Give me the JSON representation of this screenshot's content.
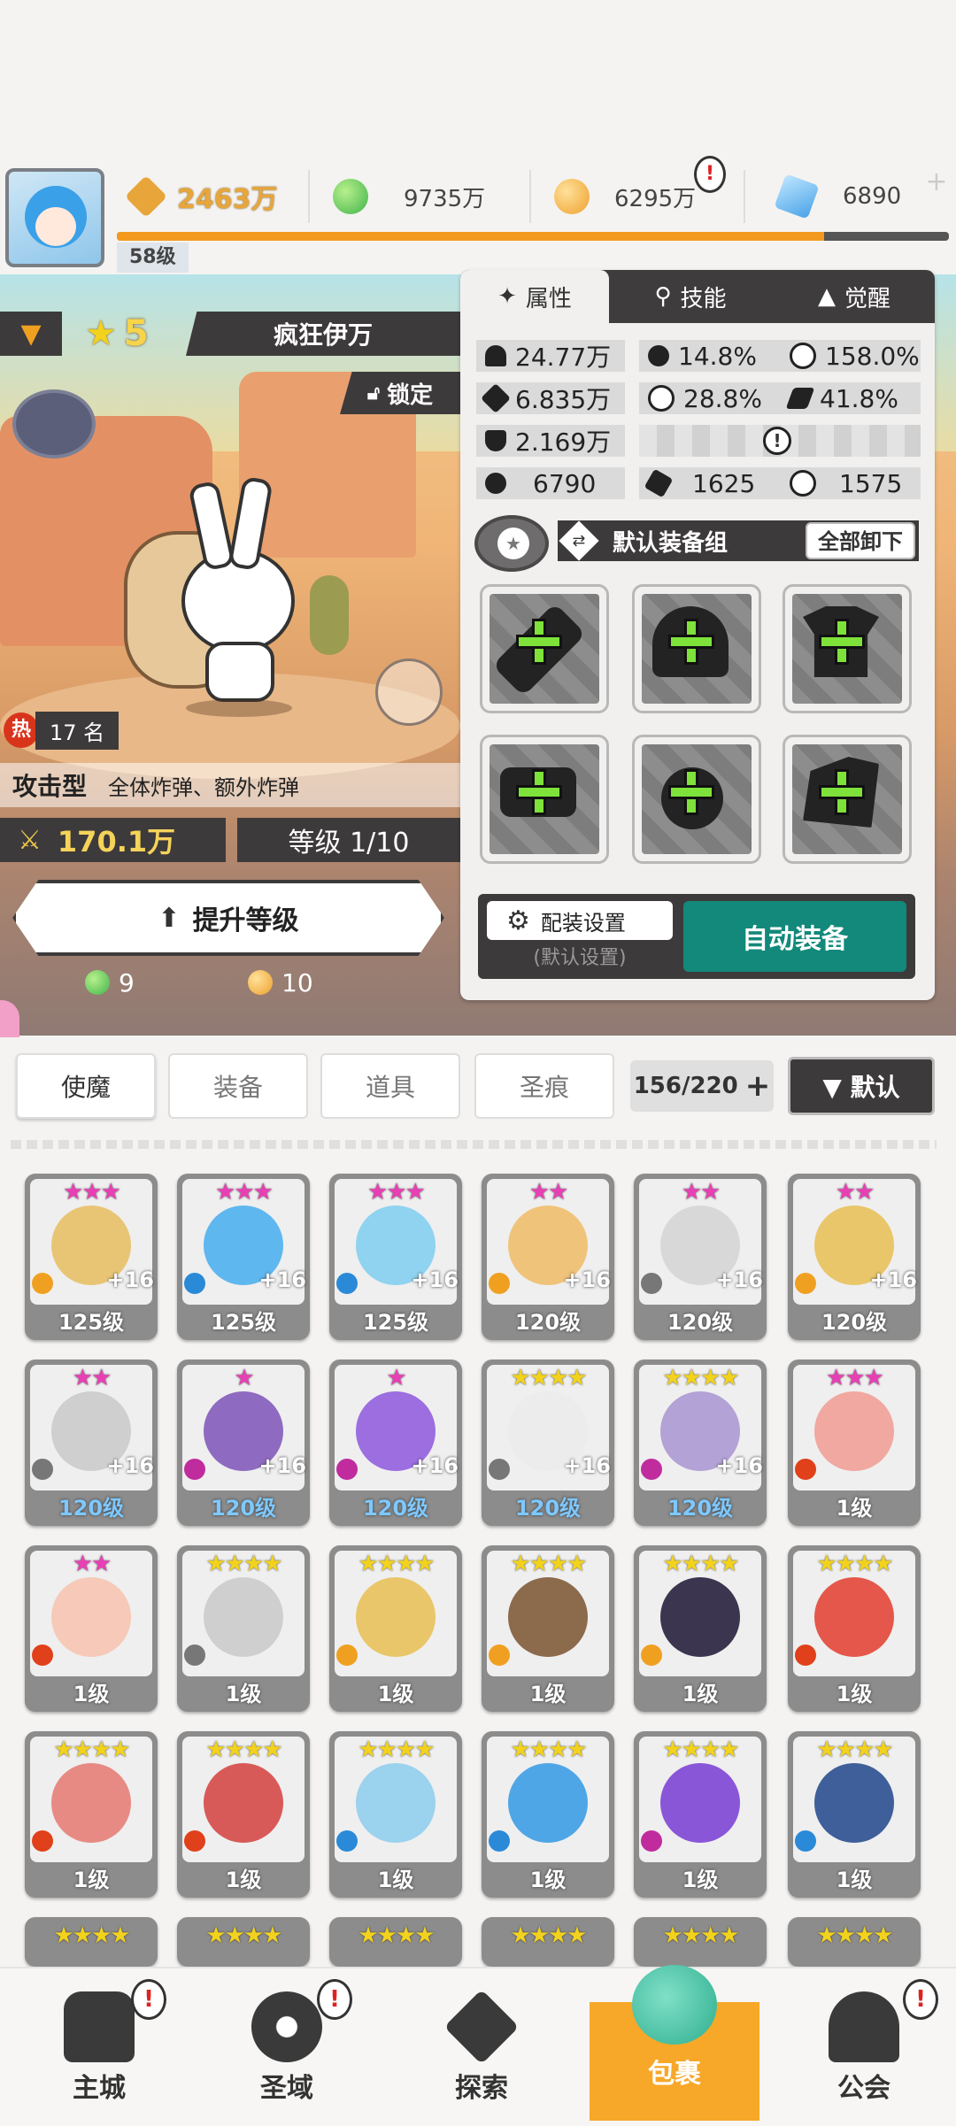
{
  "top": {
    "level": "58级",
    "power": "2463万",
    "green_currency": "9735万",
    "gold_currency": "6295万",
    "gem_currency": "6890",
    "exp_fraction": 0.85
  },
  "hero": {
    "rank_stars": "5",
    "name": "疯狂伊万",
    "lock_label": "锁定",
    "hot_label": "热",
    "hot_rank": "17 名",
    "type": "攻击型",
    "type_desc": "全体炸弹、额外炸弹",
    "power": "170.1万",
    "level_text": "等级 1/10",
    "upgrade_label": "提升等级",
    "cost_green": "9",
    "cost_gold": "10"
  },
  "panel": {
    "tabs": [
      "属性",
      "技能",
      "觉醒"
    ],
    "stats": {
      "hp": "24.77万",
      "crit": "14.8%",
      "crit_dmg": "158.0%",
      "atk": "6.835万",
      "accuracy": "28.8%",
      "speed": "41.8%",
      "def": "2.169万",
      "s1": "6790",
      "s2": "1625",
      "s3": "1575"
    },
    "equip_set": "默认装备组",
    "unequip_all": "全部卸下",
    "config_label": "配装设置",
    "config_sub": "(默认设置)",
    "auto_equip": "自动装备"
  },
  "inventory": {
    "tabs": [
      "使魔",
      "装备",
      "道具",
      "圣痕"
    ],
    "count": "156/220",
    "sort_label": "▼ 默认",
    "rows": [
      [
        {
          "stars": "★★★",
          "star_color": "#e83fb4",
          "lv": "125级",
          "plus": "+16",
          "bg": "#e8c575",
          "el": "#f0a020"
        },
        {
          "stars": "★★★",
          "star_color": "#e83fb4",
          "lv": "125级",
          "plus": "+16",
          "bg": "#5fb7ef",
          "el": "#2a8ad8"
        },
        {
          "stars": "★★★",
          "star_color": "#e83fb4",
          "lv": "125级",
          "plus": "+16",
          "bg": "#8fd3f0",
          "el": "#2a8ad8"
        },
        {
          "stars": "★★",
          "star_color": "#e83fb4",
          "lv": "120级",
          "plus": "+16",
          "bg": "#f0c37a",
          "el": "#f0a020"
        },
        {
          "stars": "★★",
          "star_color": "#e83fb4",
          "lv": "120级",
          "plus": "+16",
          "bg": "#d8d8d8",
          "el": "#777"
        },
        {
          "stars": "★★",
          "star_color": "#e83fb4",
          "lv": "120级",
          "plus": "+16",
          "bg": "#e9c66a",
          "el": "#f0a020"
        }
      ],
      [
        {
          "stars": "★★",
          "star_color": "#e83fb4",
          "lv": "120级",
          "plus": "+16",
          "bg": "#cfcfcf",
          "el": "#777",
          "blue": true
        },
        {
          "stars": "★",
          "star_color": "#e83fb4",
          "lv": "120级",
          "plus": "+16",
          "bg": "#8e6bc0",
          "el": "#c02c9e",
          "blue": true
        },
        {
          "stars": "★",
          "star_color": "#e83fb4",
          "lv": "120级",
          "plus": "+16",
          "bg": "#9c6ee0",
          "el": "#c02c9e",
          "blue": true
        },
        {
          "stars": "★★★★",
          "star_color": "#f2d21c",
          "lv": "120级",
          "plus": "+16",
          "bg": "#ececec",
          "el": "#777",
          "blue": true
        },
        {
          "stars": "★★★★",
          "star_color": "#f2d21c",
          "lv": "120级",
          "plus": "+16",
          "bg": "#b3a2d6",
          "el": "#c02c9e",
          "blue": true
        },
        {
          "stars": "★★★",
          "star_color": "#e83fb4",
          "lv": "1级",
          "plus": "",
          "bg": "#f0a8a0",
          "el": "#e0401a"
        }
      ],
      [
        {
          "stars": "★★",
          "star_color": "#e83fb4",
          "lv": "1级",
          "plus": "",
          "bg": "#f6c9b8",
          "el": "#e0401a"
        },
        {
          "stars": "★★★★",
          "star_color": "#f2d21c",
          "lv": "1级",
          "plus": "",
          "bg": "#cfcfcf",
          "el": "#777"
        },
        {
          "stars": "★★★★",
          "star_color": "#f2d21c",
          "lv": "1级",
          "plus": "",
          "bg": "#e9c66a",
          "el": "#f0a020"
        },
        {
          "stars": "★★★★",
          "star_color": "#f2d21c",
          "lv": "1级",
          "plus": "",
          "bg": "#8c6a4c",
          "el": "#f0a020"
        },
        {
          "stars": "★★★★",
          "star_color": "#f2d21c",
          "lv": "1级",
          "plus": "",
          "bg": "#3c3550",
          "el": "#f0a020"
        },
        {
          "stars": "★★★★",
          "star_color": "#f2d21c",
          "lv": "1级",
          "plus": "",
          "bg": "#e4574a",
          "el": "#e0401a"
        }
      ],
      [
        {
          "stars": "★★★★",
          "star_color": "#f2d21c",
          "lv": "1级",
          "plus": "",
          "bg": "#e88a84",
          "el": "#e0401a"
        },
        {
          "stars": "★★★★",
          "star_color": "#f2d21c",
          "lv": "1级",
          "plus": "",
          "bg": "#d85a58",
          "el": "#e0401a"
        },
        {
          "stars": "★★★★",
          "star_color": "#f2d21c",
          "lv": "1级",
          "plus": "",
          "bg": "#9bd2ee",
          "el": "#2a8ad8"
        },
        {
          "stars": "★★★★",
          "star_color": "#f2d21c",
          "lv": "1级",
          "plus": "",
          "bg": "#4fa6e6",
          "el": "#2a8ad8"
        },
        {
          "stars": "★★★★",
          "star_color": "#f2d21c",
          "lv": "1级",
          "plus": "",
          "bg": "#8a56d8",
          "el": "#c02c9e"
        },
        {
          "stars": "★★★★",
          "star_color": "#f2d21c",
          "lv": "1级",
          "plus": "",
          "bg": "#3f5f9a",
          "el": "#2a8ad8"
        }
      ]
    ],
    "partial_row_stars": [
      "★★★★",
      "★★★★",
      "★★★★",
      "★★★★",
      "★★★★",
      "★★★★"
    ]
  },
  "nav": {
    "items": [
      "主城",
      "圣域",
      "探索",
      "包裹",
      "公会"
    ],
    "active_index": 3,
    "badge": "!"
  },
  "colors": {
    "accent_orange": "#f39a1e",
    "auto_equip_teal": "#12897a",
    "nav_active": "#f7a829"
  },
  "icons": {
    "power": "crossed-swords-icon",
    "green_currency": "green-orb-icon",
    "gold_currency": "gold-coin-icon",
    "gem": "blue-crystal-icon"
  }
}
